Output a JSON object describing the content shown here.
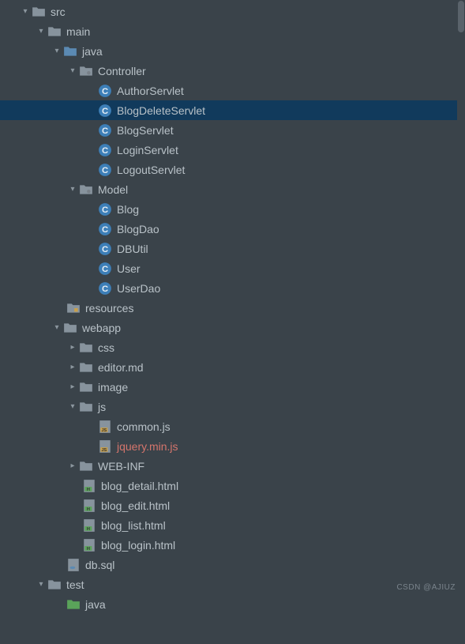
{
  "watermark": "CSDN @AJIUZ",
  "tree": {
    "src": "src",
    "main": "main",
    "java1": "java",
    "controller": "Controller",
    "authorServlet": "AuthorServlet",
    "blogDeleteServlet": "BlogDeleteServlet",
    "blogServlet": "BlogServlet",
    "loginServlet": "LoginServlet",
    "logoutServlet": "LogoutServlet",
    "model": "Model",
    "blog": "Blog",
    "blogDao": "BlogDao",
    "dbutil": "DBUtil",
    "user": "User",
    "userDao": "UserDao",
    "resources": "resources",
    "webapp": "webapp",
    "css": "css",
    "editormd": "editor.md",
    "image": "image",
    "js": "js",
    "commonjs": "common.js",
    "jquerymin": "jquery.min.js",
    "webinf": "WEB-INF",
    "blogDetail": "blog_detail.html",
    "blogEdit": "blog_edit.html",
    "blogList": "blog_list.html",
    "blogLogin": "blog_login.html",
    "dbsql": "db.sql",
    "test": "test",
    "java2": "java"
  }
}
